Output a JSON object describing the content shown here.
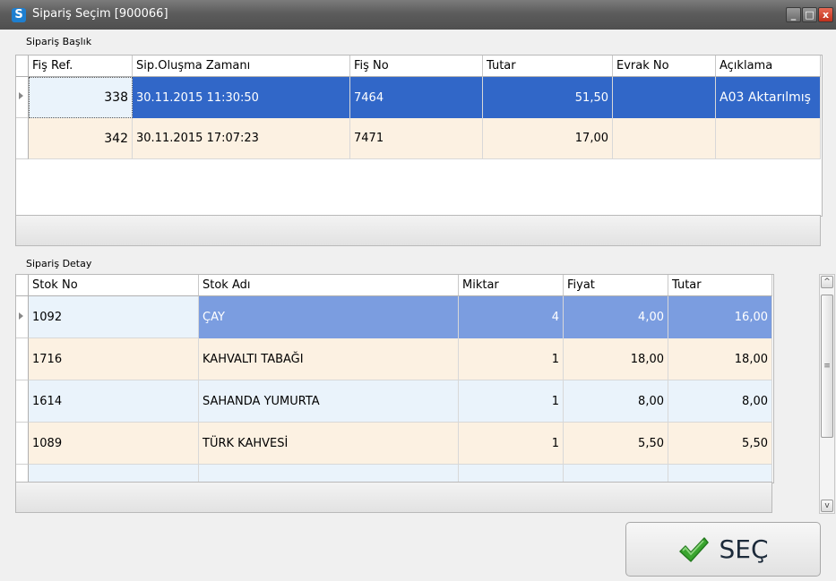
{
  "window": {
    "icon_letter": "S",
    "title": "Sipariş Seçim  [900066]",
    "minimize": "_",
    "maximize": "□",
    "close": "x"
  },
  "header_section": {
    "label": "Sipariş Başlık",
    "columns": [
      "Fiş Ref.",
      "Sip.Oluşma Zamanı",
      "Fiş No",
      "Tutar",
      "Evrak No",
      "Açıklama"
    ],
    "rows": [
      {
        "fis_ref": "338",
        "zaman": "30.11.2015 11:30:50",
        "fis_no": "7464",
        "tutar": "51,50",
        "evrak_no": "",
        "aciklama": "A03 Aktarılmış",
        "selected": true
      },
      {
        "fis_ref": "342",
        "zaman": "30.11.2015 17:07:23",
        "fis_no": "7471",
        "tutar": "17,00",
        "evrak_no": "",
        "aciklama": "",
        "selected": false
      }
    ]
  },
  "detail_section": {
    "label": "Sipariş Detay",
    "columns": [
      "Stok No",
      "Stok Adı",
      "Miktar",
      "Fiyat",
      "Tutar"
    ],
    "rows": [
      {
        "stok_no": "1092",
        "stok_adi": "ÇAY",
        "miktar": "4",
        "fiyat": "4,00",
        "tutar": "16,00",
        "selected": true
      },
      {
        "stok_no": "1716",
        "stok_adi": "KAHVALTI TABAĞI",
        "miktar": "1",
        "fiyat": "18,00",
        "tutar": "18,00",
        "selected": false
      },
      {
        "stok_no": "1614",
        "stok_adi": "SAHANDA YUMURTA",
        "miktar": "1",
        "fiyat": "8,00",
        "tutar": "8,00",
        "selected": false
      },
      {
        "stok_no": "1089",
        "stok_adi": "TÜRK KAHVESİ",
        "miktar": "1",
        "fiyat": "5,50",
        "tutar": "5,50",
        "selected": false
      }
    ]
  },
  "scrollbar": {
    "up": "^",
    "down": "v",
    "grip": "≡"
  },
  "select_button": {
    "label": "SEÇ",
    "icon": "checkmark-icon"
  },
  "colors": {
    "selected_row_header": "#3167c8",
    "selected_row_detail": "#7b9de0",
    "row_cream": "#fcf1e2",
    "row_blue": "#eaf3fb",
    "check_green": "#39a82e"
  }
}
